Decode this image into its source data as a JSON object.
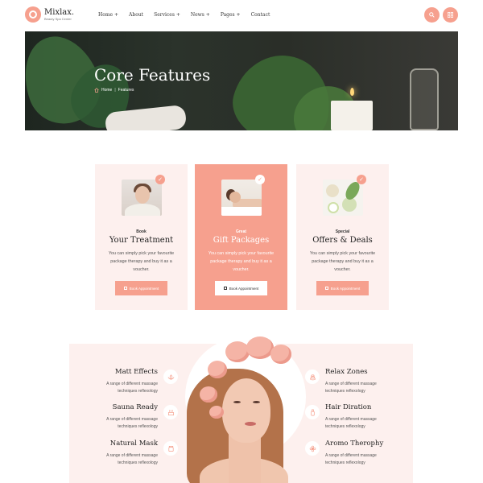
{
  "brand": {
    "name": "Mixlax.",
    "tagline": "Beauty Spa Center"
  },
  "nav": {
    "items": [
      "Home +",
      "About",
      "Services +",
      "News +",
      "Pages +",
      "Contact"
    ]
  },
  "header": {
    "search_icon": "search-icon",
    "menu_icon": "grid-menu-icon"
  },
  "hero": {
    "title": "Core Features",
    "breadcrumb": {
      "home": "Home",
      "separator": "|",
      "current": "Features"
    }
  },
  "cards": [
    {
      "eyebrow": "Book",
      "title": "Your Treatment",
      "desc": "You can simply pick your favourite package therapy and buy it as a voucher.",
      "button": "Book Appointment"
    },
    {
      "eyebrow": "Great",
      "title": "Gift Packages",
      "desc": "You can simply pick your favourite package therapy and buy it as a voucher.",
      "button": "Book Appointment"
    },
    {
      "eyebrow": "Special",
      "title": "Offers & Deals",
      "desc": "You can simply pick your favourite package therapy and buy it as a voucher.",
      "button": "Book Appointment"
    }
  ],
  "services": {
    "left": [
      {
        "title": "Matt Effects",
        "desc": "A range of different massage techniques reflexology"
      },
      {
        "title": "Sauna Ready",
        "desc": "A range of different massage techniques reflexology"
      },
      {
        "title": "Natural Mask",
        "desc": "A range of different massage techniques reflexology"
      }
    ],
    "right": [
      {
        "title": "Relax Zones",
        "desc": "A range of different massage techniques reflexology"
      },
      {
        "title": "Hair Diration",
        "desc": "A range of different massage techniques reflexology"
      },
      {
        "title": "Aromo Therophy",
        "desc": "A range of different massage techniques reflexology"
      }
    ]
  },
  "colors": {
    "accent": "#f6a08e",
    "card_bg": "#fdf0ee",
    "text_dark": "#222222"
  }
}
